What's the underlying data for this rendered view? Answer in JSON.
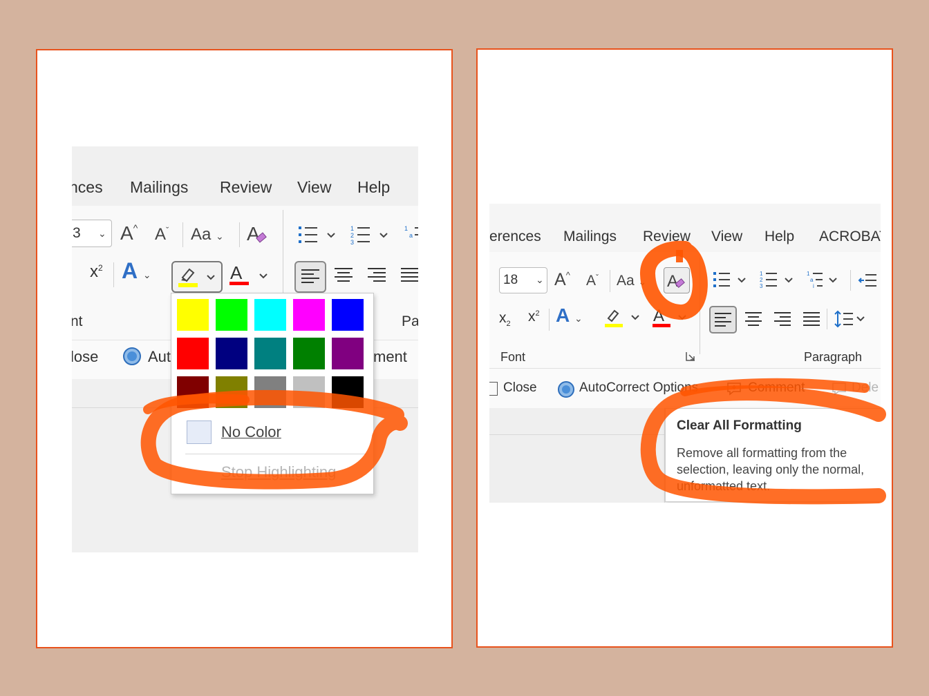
{
  "left": {
    "tabs": [
      "nces",
      "Mailings",
      "Review",
      "View",
      "Help"
    ],
    "font_size_value": "3",
    "grow_label": "A",
    "shrink_label": "A",
    "change_case_label": "Aa",
    "superscript_label": "x",
    "superscript_mark": "2",
    "group_font_label": "nt",
    "group_paragraph_label": "Pa",
    "close_label": "lose",
    "autocorrect_label": "Aut",
    "comment_label": "ment",
    "palette_colors": [
      [
        "#ffff00",
        "#00ff00",
        "#00ffff",
        "#ff00ff",
        "#0000ff"
      ],
      [
        "#ff0000",
        "#000080",
        "#008080",
        "#008000",
        "#800080"
      ],
      [
        "#800000",
        "#808000",
        "#808080",
        "#c0c0c0",
        "#000000"
      ]
    ],
    "no_color_label": "No Color",
    "stop_highlighting_label": "Stop Highlighting",
    "highlight_color": "#ffff00",
    "font_color": "#ff0000"
  },
  "right": {
    "tabs": [
      "erences",
      "Mailings",
      "Review",
      "View",
      "Help",
      "ACROBAT"
    ],
    "font_size_value": "18",
    "grow_label": "A",
    "shrink_label": "A",
    "change_case_label": "Aa",
    "subscript_label": "x",
    "subscript_mark": "2",
    "superscript_label": "x",
    "superscript_mark": "2",
    "group_font_label": "Font",
    "group_paragraph_label": "Paragraph",
    "close_label": "Close",
    "autocorrect_label": "AutoCorrect Options",
    "comment_label": "Comment",
    "delete_label": "Dele",
    "tooltip_title": "Clear All Formatting",
    "tooltip_lines": [
      "Remove all formatting from the",
      "selection, leaving only the normal,",
      "unformatted text."
    ]
  },
  "annotation_color": "#ff5500",
  "border_color": "#e8521c",
  "background_color": "#d4b39e"
}
